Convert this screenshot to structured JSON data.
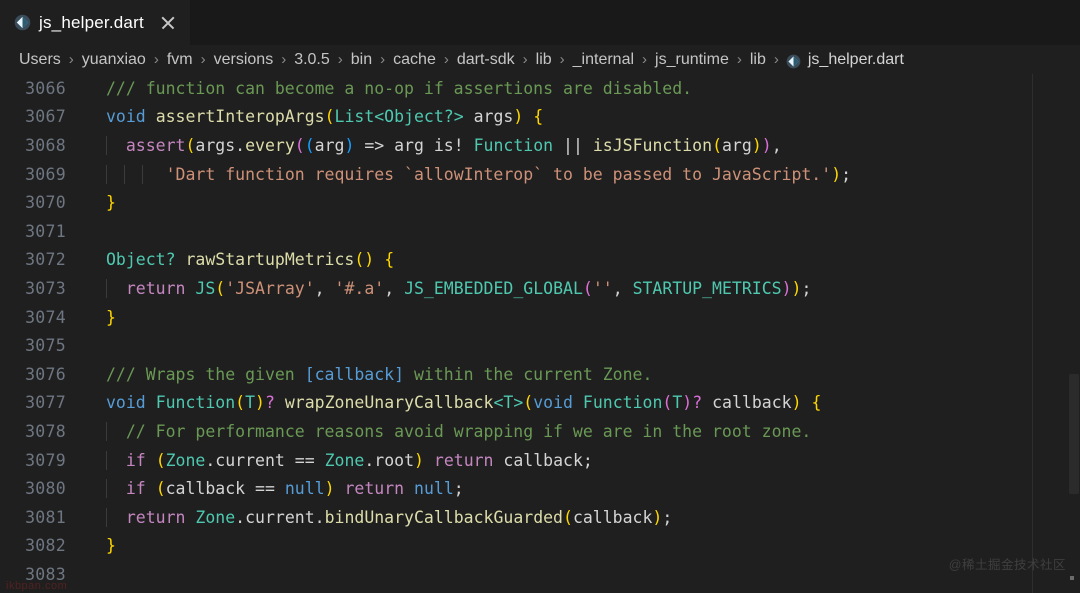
{
  "window": {
    "background": "#1f1f1f",
    "tab_bar_background": "#191919"
  },
  "tab": {
    "label": "js_helper.dart",
    "icon": "dart-file-icon",
    "close_icon": "close-icon"
  },
  "breadcrumb": {
    "separator": "›",
    "file_icon": "dart-file-icon",
    "items": [
      "Users",
      "yuanxiao",
      "fvm",
      "versions",
      "3.0.5",
      "bin",
      "cache",
      "dart-sdk",
      "lib",
      "_internal",
      "js_runtime",
      "lib",
      "js_helper.dart"
    ]
  },
  "editor": {
    "first_line_number": 3066,
    "lines": [
      {
        "no": "3066",
        "guides": [],
        "tokens": [
          {
            "c": "t-doc",
            "t": "/// function can become a no-op if assertions are disabled."
          }
        ]
      },
      {
        "no": "3067",
        "guides": [],
        "tokens": [
          {
            "c": "t-kw",
            "t": "void"
          },
          {
            "c": "t-op",
            "t": " "
          },
          {
            "c": "t-fn",
            "t": "assertInteropArgs"
          },
          {
            "c": "t-p1",
            "t": "("
          },
          {
            "c": "t-type",
            "t": "List<Object?>"
          },
          {
            "c": "t-op",
            "t": " args"
          },
          {
            "c": "t-p1",
            "t": ")"
          },
          {
            "c": "t-op",
            "t": " "
          },
          {
            "c": "t-p1",
            "t": "{"
          }
        ]
      },
      {
        "no": "3068",
        "guides": [
          28
        ],
        "tokens": [
          {
            "c": "t-op",
            "t": "  "
          },
          {
            "c": "t-ctl",
            "t": "assert"
          },
          {
            "c": "t-p1",
            "t": "("
          },
          {
            "c": "t-op",
            "t": "args."
          },
          {
            "c": "t-fn",
            "t": "every"
          },
          {
            "c": "t-p2",
            "t": "("
          },
          {
            "c": "t-p3",
            "t": "("
          },
          {
            "c": "t-op",
            "t": "arg"
          },
          {
            "c": "t-p3",
            "t": ")"
          },
          {
            "c": "t-op",
            "t": " => arg is! "
          },
          {
            "c": "t-type",
            "t": "Function"
          },
          {
            "c": "t-op",
            "t": " || "
          },
          {
            "c": "t-fn",
            "t": "isJSFunction"
          },
          {
            "c": "t-p1",
            "t": "("
          },
          {
            "c": "t-op",
            "t": "arg"
          },
          {
            "c": "t-p1",
            "t": ")"
          },
          {
            "c": "t-p2",
            "t": ")"
          },
          {
            "c": "t-op",
            "t": ","
          }
        ]
      },
      {
        "no": "3069",
        "guides": [
          28,
          46,
          64
        ],
        "tokens": [
          {
            "c": "t-op",
            "t": "      "
          },
          {
            "c": "t-str",
            "t": "'Dart function requires `allowInterop` to be passed to JavaScript.'"
          },
          {
            "c": "t-p1",
            "t": ")"
          },
          {
            "c": "t-op",
            "t": ";"
          }
        ]
      },
      {
        "no": "3070",
        "guides": [],
        "tokens": [
          {
            "c": "t-p1",
            "t": "}"
          }
        ]
      },
      {
        "no": "3071",
        "guides": [],
        "tokens": []
      },
      {
        "no": "3072",
        "guides": [],
        "tokens": [
          {
            "c": "t-type",
            "t": "Object?"
          },
          {
            "c": "t-op",
            "t": " "
          },
          {
            "c": "t-fn",
            "t": "rawStartupMetrics"
          },
          {
            "c": "t-p1",
            "t": "()"
          },
          {
            "c": "t-op",
            "t": " "
          },
          {
            "c": "t-p1",
            "t": "{"
          }
        ]
      },
      {
        "no": "3073",
        "guides": [
          28
        ],
        "tokens": [
          {
            "c": "t-op",
            "t": "  "
          },
          {
            "c": "t-ctl",
            "t": "return"
          },
          {
            "c": "t-op",
            "t": " "
          },
          {
            "c": "t-type",
            "t": "JS"
          },
          {
            "c": "t-p1",
            "t": "("
          },
          {
            "c": "t-str",
            "t": "'JSArray'"
          },
          {
            "c": "t-op",
            "t": ", "
          },
          {
            "c": "t-str",
            "t": "'#.a'"
          },
          {
            "c": "t-op",
            "t": ", "
          },
          {
            "c": "t-type",
            "t": "JS_EMBEDDED_GLOBAL"
          },
          {
            "c": "t-p2",
            "t": "("
          },
          {
            "c": "t-str",
            "t": "''"
          },
          {
            "c": "t-op",
            "t": ", "
          },
          {
            "c": "t-type",
            "t": "STARTUP_METRICS"
          },
          {
            "c": "t-p2",
            "t": ")"
          },
          {
            "c": "t-p1",
            "t": ")"
          },
          {
            "c": "t-op",
            "t": ";"
          }
        ]
      },
      {
        "no": "3074",
        "guides": [],
        "tokens": [
          {
            "c": "t-p1",
            "t": "}"
          }
        ]
      },
      {
        "no": "3075",
        "guides": [],
        "tokens": []
      },
      {
        "no": "3076",
        "guides": [],
        "tokens": [
          {
            "c": "t-doc",
            "t": "/// Wraps the given "
          },
          {
            "c": "t-doc-ref",
            "t": "[callback]"
          },
          {
            "c": "t-doc",
            "t": " within the current Zone."
          }
        ]
      },
      {
        "no": "3077",
        "guides": [],
        "tokens": [
          {
            "c": "t-kw",
            "t": "void"
          },
          {
            "c": "t-op",
            "t": " "
          },
          {
            "c": "t-type",
            "t": "Function"
          },
          {
            "c": "t-p1",
            "t": "("
          },
          {
            "c": "t-type",
            "t": "T"
          },
          {
            "c": "t-p1",
            "t": ")"
          },
          {
            "c": "t-p2",
            "t": "?"
          },
          {
            "c": "t-op",
            "t": " "
          },
          {
            "c": "t-fn",
            "t": "wrapZoneUnaryCallback"
          },
          {
            "c": "t-type",
            "t": "<T>"
          },
          {
            "c": "t-p1",
            "t": "("
          },
          {
            "c": "t-kw",
            "t": "void"
          },
          {
            "c": "t-op",
            "t": " "
          },
          {
            "c": "t-type",
            "t": "Function"
          },
          {
            "c": "t-p2",
            "t": "("
          },
          {
            "c": "t-type",
            "t": "T"
          },
          {
            "c": "t-p2",
            "t": ")"
          },
          {
            "c": "t-p2",
            "t": "?"
          },
          {
            "c": "t-op",
            "t": " callback"
          },
          {
            "c": "t-p1",
            "t": ")"
          },
          {
            "c": "t-op",
            "t": " "
          },
          {
            "c": "t-p1",
            "t": "{"
          }
        ]
      },
      {
        "no": "3078",
        "guides": [
          28
        ],
        "tokens": [
          {
            "c": "t-op",
            "t": "  "
          },
          {
            "c": "t-comment",
            "t": "// For performance reasons avoid wrapping if we are in the root zone."
          }
        ]
      },
      {
        "no": "3079",
        "guides": [
          28
        ],
        "tokens": [
          {
            "c": "t-op",
            "t": "  "
          },
          {
            "c": "t-ctl",
            "t": "if"
          },
          {
            "c": "t-op",
            "t": " "
          },
          {
            "c": "t-p1",
            "t": "("
          },
          {
            "c": "t-type",
            "t": "Zone"
          },
          {
            "c": "t-op",
            "t": ".current == "
          },
          {
            "c": "t-type",
            "t": "Zone"
          },
          {
            "c": "t-op",
            "t": ".root"
          },
          {
            "c": "t-p1",
            "t": ")"
          },
          {
            "c": "t-op",
            "t": " "
          },
          {
            "c": "t-ctl",
            "t": "return"
          },
          {
            "c": "t-op",
            "t": " callback;"
          }
        ]
      },
      {
        "no": "3080",
        "guides": [
          28
        ],
        "tokens": [
          {
            "c": "t-op",
            "t": "  "
          },
          {
            "c": "t-ctl",
            "t": "if"
          },
          {
            "c": "t-op",
            "t": " "
          },
          {
            "c": "t-p1",
            "t": "("
          },
          {
            "c": "t-op",
            "t": "callback == "
          },
          {
            "c": "t-kw",
            "t": "null"
          },
          {
            "c": "t-p1",
            "t": ")"
          },
          {
            "c": "t-op",
            "t": " "
          },
          {
            "c": "t-ctl",
            "t": "return"
          },
          {
            "c": "t-op",
            "t": " "
          },
          {
            "c": "t-kw",
            "t": "null"
          },
          {
            "c": "t-op",
            "t": ";"
          }
        ]
      },
      {
        "no": "3081",
        "guides": [
          28
        ],
        "tokens": [
          {
            "c": "t-op",
            "t": "  "
          },
          {
            "c": "t-ctl",
            "t": "return"
          },
          {
            "c": "t-op",
            "t": " "
          },
          {
            "c": "t-type",
            "t": "Zone"
          },
          {
            "c": "t-op",
            "t": ".current."
          },
          {
            "c": "t-fn",
            "t": "bindUnaryCallbackGuarded"
          },
          {
            "c": "t-p1",
            "t": "("
          },
          {
            "c": "t-op",
            "t": "callback"
          },
          {
            "c": "t-p1",
            "t": ")"
          },
          {
            "c": "t-op",
            "t": ";"
          }
        ]
      },
      {
        "no": "3082",
        "guides": [],
        "tokens": [
          {
            "c": "t-p1",
            "t": "}"
          }
        ]
      },
      {
        "no": "3083",
        "guides": [],
        "tokens": []
      }
    ]
  },
  "watermarks": {
    "right": "@稀土掘金技术社区",
    "left": "ikbpan.com"
  }
}
